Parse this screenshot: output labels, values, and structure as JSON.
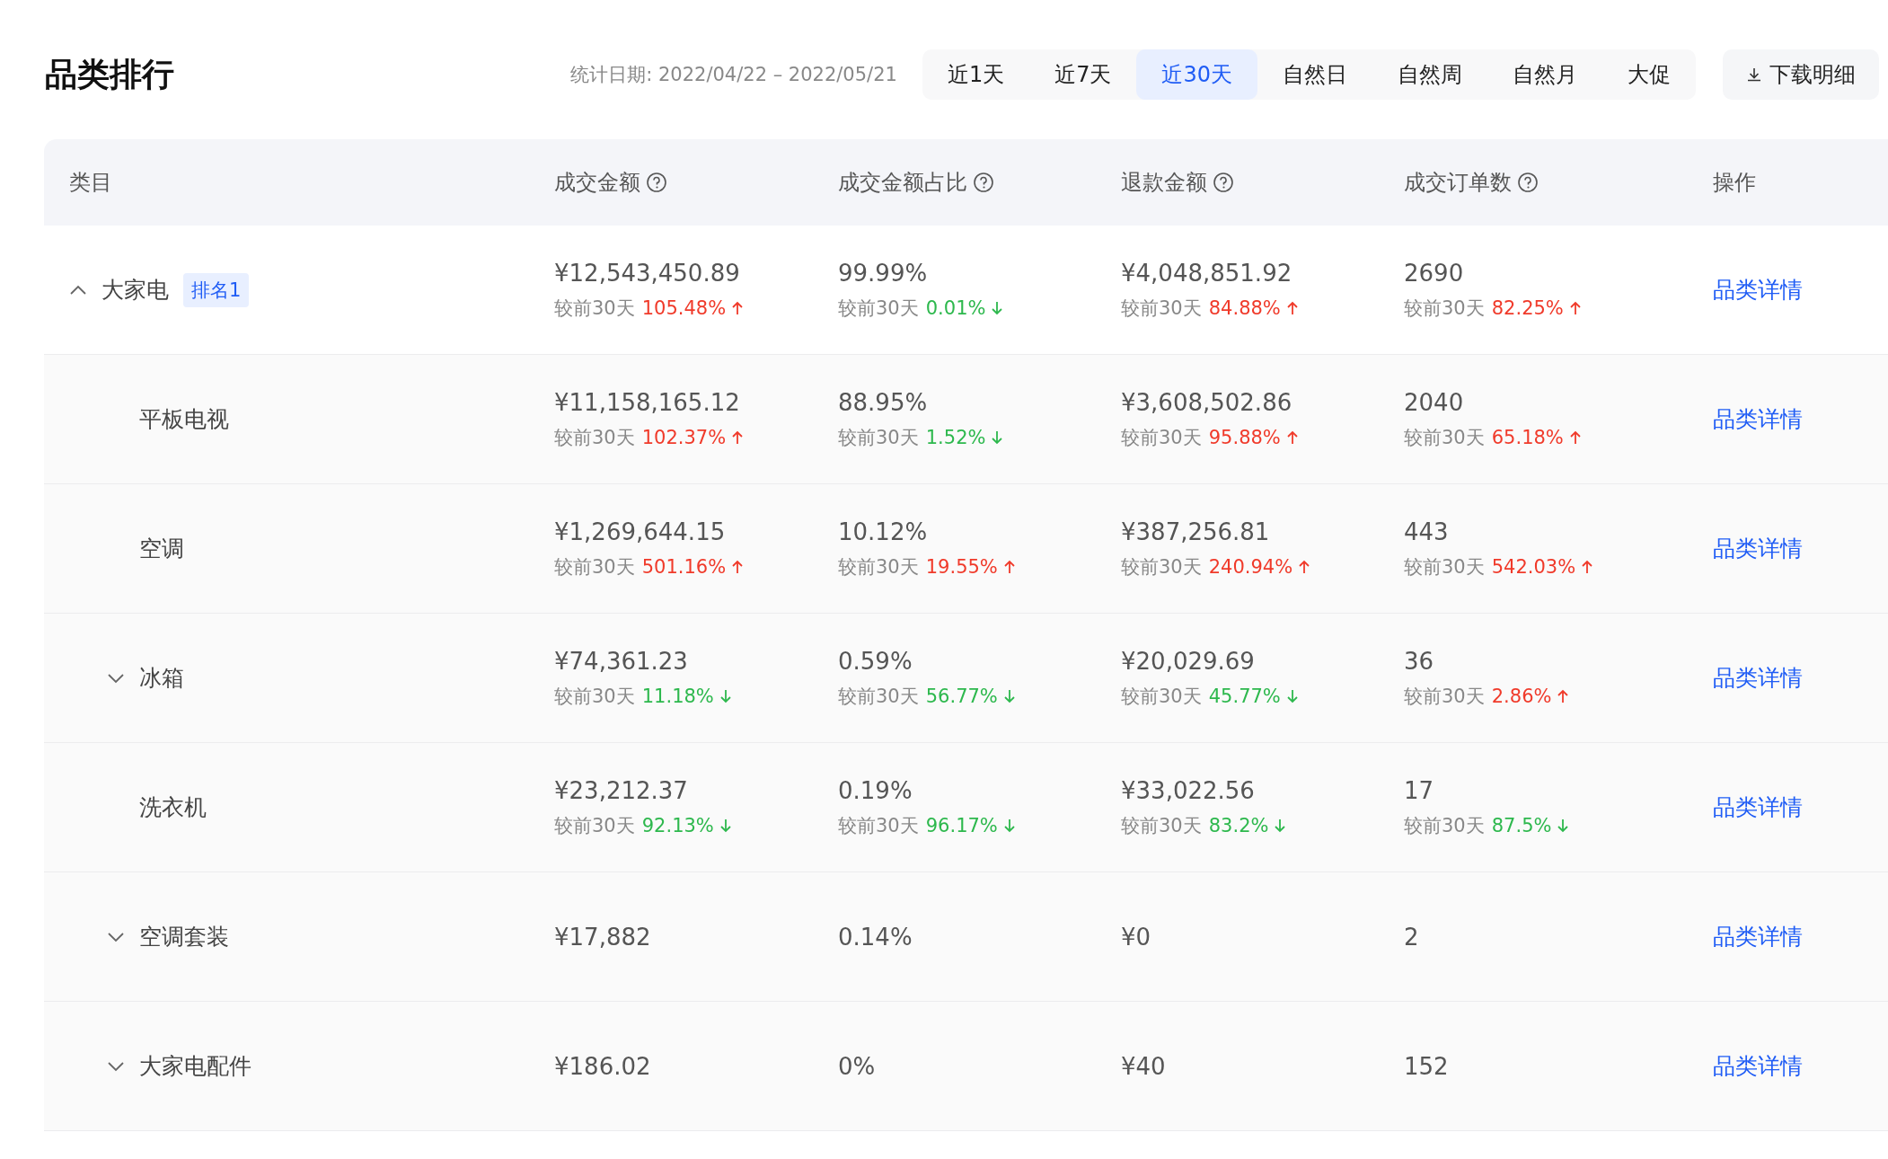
{
  "title": "品类排行",
  "date_range": {
    "label": "统计日期:",
    "value": "2022/04/22 – 2022/05/21"
  },
  "tabs": [
    {
      "label": "近1天",
      "selected": false
    },
    {
      "label": "近7天",
      "selected": false
    },
    {
      "label": "近30天",
      "selected": true
    },
    {
      "label": "自然日",
      "selected": false
    },
    {
      "label": "自然周",
      "selected": false
    },
    {
      "label": "自然月",
      "selected": false
    },
    {
      "label": "大促",
      "selected": false
    }
  ],
  "download_button": "下载明细",
  "table": {
    "columns": [
      {
        "label": "类目",
        "help": false
      },
      {
        "label": "成交金额",
        "help": true
      },
      {
        "label": "成交金额占比",
        "help": true
      },
      {
        "label": "退款金额",
        "help": true
      },
      {
        "label": "成交订单数",
        "help": true
      },
      {
        "label": "操作",
        "help": false
      }
    ],
    "rows": [
      {
        "kind": "group",
        "expanded": true,
        "name": "大家电",
        "badge": "排名1",
        "action": "品类详情",
        "metrics": [
          {
            "value": "¥12,543,450.89",
            "compare": "较前30天",
            "change": "105.48%",
            "rising": true
          },
          {
            "value": "99.99%",
            "compare": "较前30天",
            "change": "0.01%",
            "rising": false
          },
          {
            "value": "¥4,048,851.92",
            "compare": "较前30天",
            "change": "84.88%",
            "rising": true
          },
          {
            "value": "2690",
            "compare": "较前30天",
            "change": "82.25%",
            "rising": true
          }
        ],
        "children": [
          {
            "kind": "leaf",
            "name": "平板电视",
            "action": "品类详情",
            "metrics": [
              {
                "value": "¥11,158,165.12",
                "compare": "较前30天",
                "change": "102.37%",
                "rising": true
              },
              {
                "value": "88.95%",
                "compare": "较前30天",
                "change": "1.52%",
                "rising": false
              },
              {
                "value": "¥3,608,502.86",
                "compare": "较前30天",
                "change": "95.88%",
                "rising": true
              },
              {
                "value": "2040",
                "compare": "较前30天",
                "change": "65.18%",
                "rising": true
              }
            ]
          },
          {
            "kind": "leaf",
            "name": "空调",
            "action": "品类详情",
            "metrics": [
              {
                "value": "¥1,269,644.15",
                "compare": "较前30天",
                "change": "501.16%",
                "rising": true
              },
              {
                "value": "10.12%",
                "compare": "较前30天",
                "change": "19.55%",
                "rising": true
              },
              {
                "value": "¥387,256.81",
                "compare": "较前30天",
                "change": "240.94%",
                "rising": true
              },
              {
                "value": "443",
                "compare": "较前30天",
                "change": "542.03%",
                "rising": true
              }
            ]
          },
          {
            "kind": "group",
            "expanded": false,
            "name": "冰箱",
            "action": "品类详情",
            "metrics": [
              {
                "value": "¥74,361.23",
                "compare": "较前30天",
                "change": "11.18%",
                "rising": false
              },
              {
                "value": "0.59%",
                "compare": "较前30天",
                "change": "56.77%",
                "rising": false
              },
              {
                "value": "¥20,029.69",
                "compare": "较前30天",
                "change": "45.77%",
                "rising": false
              },
              {
                "value": "36",
                "compare": "较前30天",
                "change": "2.86%",
                "rising": true
              }
            ]
          },
          {
            "kind": "leaf",
            "name": "洗衣机",
            "action": "品类详情",
            "metrics": [
              {
                "value": "¥23,212.37",
                "compare": "较前30天",
                "change": "92.13%",
                "rising": false
              },
              {
                "value": "0.19%",
                "compare": "较前30天",
                "change": "96.17%",
                "rising": false
              },
              {
                "value": "¥33,022.56",
                "compare": "较前30天",
                "change": "83.2%",
                "rising": false
              },
              {
                "value": "17",
                "compare": "较前30天",
                "change": "87.5%",
                "rising": false
              }
            ]
          },
          {
            "kind": "group",
            "expanded": false,
            "name": "空调套装",
            "action": "品类详情",
            "metrics": [
              {
                "value": "¥17,882"
              },
              {
                "value": "0.14%"
              },
              {
                "value": "¥0"
              },
              {
                "value": "2"
              }
            ]
          },
          {
            "kind": "group",
            "expanded": false,
            "name": "大家电配件",
            "action": "品类详情",
            "metrics": [
              {
                "value": "¥186.02"
              },
              {
                "value": "0%"
              },
              {
                "value": "¥40"
              },
              {
                "value": "152"
              }
            ]
          }
        ]
      }
    ]
  }
}
